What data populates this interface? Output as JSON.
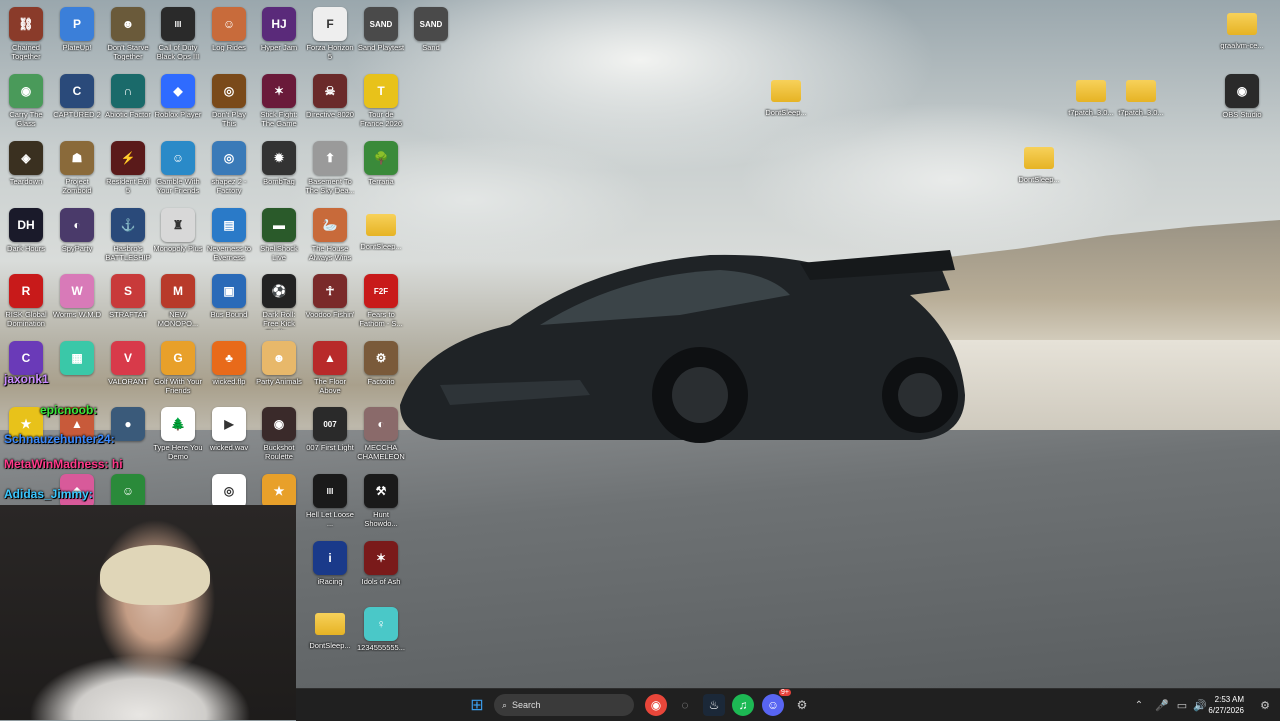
{
  "desktop": {
    "icons": [
      {
        "label": "Chained Together",
        "color": "#8a3b2a",
        "glyph": "⛓"
      },
      {
        "label": "PlateUp!",
        "color": "#3b7fd9",
        "glyph": "P"
      },
      {
        "label": "Don't Starve Together",
        "color": "#6a5a3a",
        "glyph": "☻"
      },
      {
        "label": "Call of Duty Black Ops III",
        "color": "#2a2a2a",
        "glyph": "III"
      },
      {
        "label": "Log Rides",
        "color": "#c86b3b",
        "glyph": "☺"
      },
      {
        "label": "Hyper Jam",
        "color": "#5a2a7a",
        "glyph": "HJ"
      },
      {
        "label": "Forza Horizon 5",
        "color": "#eeeeee",
        "glyph": "F"
      },
      {
        "label": "Sand Playtest",
        "color": "#4a4a4a",
        "glyph": "SAND"
      },
      {
        "label": "Sand",
        "color": "#4a4a4a",
        "glyph": "SAND"
      },
      {
        "label": "Carry The Glass",
        "color": "#4a9a5a",
        "glyph": "◉"
      },
      {
        "label": "CAPTURED 2",
        "color": "#2a4a7a",
        "glyph": "C"
      },
      {
        "label": "Abiotic Factor",
        "color": "#1a6a6a",
        "glyph": "∩"
      },
      {
        "label": "Roblox Player",
        "color": "#2f6bff",
        "glyph": "◆"
      },
      {
        "label": "Don't Play This",
        "color": "#7a4a1a",
        "glyph": "◎"
      },
      {
        "label": "Stick Fight: The Game",
        "color": "#6a1a3a",
        "glyph": "✶"
      },
      {
        "label": "Directive 8020",
        "color": "#6a2a2a",
        "glyph": "☠"
      },
      {
        "label": "Tour de France 2026",
        "color": "#e8c21a",
        "glyph": "T"
      },
      {
        "label": "Teardown",
        "color": "#3a3020",
        "glyph": "◈"
      },
      {
        "label": "Project Zomboid",
        "color": "#8a6a3a",
        "glyph": "☗"
      },
      {
        "label": "Resident Evil 5",
        "color": "#5a1a1a",
        "glyph": "⚡"
      },
      {
        "label": "Gamble With Your Friends",
        "color": "#2a8ac8",
        "glyph": "☺"
      },
      {
        "label": "shapez 2 - Factory",
        "color": "#3a7ab8",
        "glyph": "◎"
      },
      {
        "label": "BombTag",
        "color": "#333333",
        "glyph": "✹"
      },
      {
        "label": "Basement To The Sky Dea...",
        "color": "#9a9a9a",
        "glyph": "⬆"
      },
      {
        "label": "Terraria",
        "color": "#3a8a3a",
        "glyph": "🌳"
      },
      {
        "label": "Dark Hours",
        "color": "#1a1a2a",
        "glyph": "DH"
      },
      {
        "label": "SpyParty",
        "color": "#4a3a6a",
        "glyph": "◐"
      },
      {
        "label": "Hasbro's BATTLESHIP",
        "color": "#2a4a7a",
        "glyph": "⚓"
      },
      {
        "label": "Monopoly Plus",
        "color": "#d8d8d8",
        "glyph": "♜"
      },
      {
        "label": "Neverness to Everness",
        "color": "#2a7ac8",
        "glyph": "▤"
      },
      {
        "label": "ShellShock Live",
        "color": "#2a5a2a",
        "glyph": "▬"
      },
      {
        "label": "The House Always Wins",
        "color": "#c86a3a",
        "glyph": "🦢"
      },
      {
        "label": "DontSleep...",
        "color": "#f0c030",
        "glyph": "",
        "folder": true
      },
      {
        "label": "RISK Global Domination",
        "color": "#c81a1a",
        "glyph": "R"
      },
      {
        "label": "Worms W.M.D",
        "color": "#d87ab8",
        "glyph": "W"
      },
      {
        "label": "STRAFTAT",
        "color": "#c83a3a",
        "glyph": "S"
      },
      {
        "label": "NEW MONOPO...",
        "color": "#b83a2a",
        "glyph": "M"
      },
      {
        "label": "Bus Bound",
        "color": "#2a6ab8",
        "glyph": "▣"
      },
      {
        "label": "Dark Roll: Free Kick Challe...",
        "color": "#222222",
        "glyph": "⚽"
      },
      {
        "label": "Voodoo Fishin'",
        "color": "#7a2a2a",
        "glyph": "☥"
      },
      {
        "label": "Fears to Fathom - S...",
        "color": "#c81a1a",
        "glyph": "F2F"
      },
      {
        "label": "",
        "color": "#6a3ab8",
        "glyph": "C"
      },
      {
        "label": "",
        "color": "#3ac8a8",
        "glyph": "▦"
      },
      {
        "label": "VALORANT",
        "color": "#d83a4a",
        "glyph": "V"
      },
      {
        "label": "Golf With Your Friends",
        "color": "#e8a02a",
        "glyph": "G"
      },
      {
        "label": "wicked.flp",
        "color": "#e86a1a",
        "glyph": "♣"
      },
      {
        "label": "Party Animals",
        "color": "#e8b86a",
        "glyph": "☻"
      },
      {
        "label": "The Floor Above",
        "color": "#b82a2a",
        "glyph": "▲"
      },
      {
        "label": "Factorio",
        "color": "#7a5a3a",
        "glyph": "⚙"
      },
      {
        "label": "",
        "color": "#e8c21a",
        "glyph": "★"
      },
      {
        "label": "",
        "color": "#c85a3a",
        "glyph": "▲"
      },
      {
        "label": "",
        "color": "#3a5a7a",
        "glyph": "●"
      },
      {
        "label": "Type Here You Demo",
        "color": "#ffffff",
        "glyph": "🌲"
      },
      {
        "label": "wicked.wav",
        "color": "#ffffff",
        "glyph": "▶"
      },
      {
        "label": "Buckshot Roulette",
        "color": "#3a2a2a",
        "glyph": "◉"
      },
      {
        "label": "007 First Light",
        "color": "#2a2a2a",
        "glyph": "007"
      },
      {
        "label": "MECCHA CHAMELEON",
        "color": "#8a6a6a",
        "glyph": "◐"
      },
      {
        "label": "",
        "color": "#d85a9a",
        "glyph": "◆"
      },
      {
        "label": "",
        "color": "#2a8a3a",
        "glyph": "☺"
      },
      {
        "label": "",
        "color": "#ffffff",
        "glyph": "◎"
      },
      {
        "label": "",
        "color": "#e8a02a",
        "glyph": "★"
      },
      {
        "label": "Hell Let Loose ...",
        "color": "#1a1a1a",
        "glyph": "III"
      },
      {
        "label": "Hunt Showdo...",
        "color": "#1a1a1a",
        "glyph": "⚒"
      },
      {
        "label": "iRacing",
        "color": "#1a3a8a",
        "glyph": "i"
      },
      {
        "label": "Idols of Ash",
        "color": "#7a1a1a",
        "glyph": "✶"
      },
      {
        "label": "DontSleep...",
        "color": "#f0c030",
        "glyph": "",
        "folder": true
      },
      {
        "label": "1234555555...",
        "color": "#4ac8c8",
        "glyph": "♀"
      },
      {
        "label": "DontSleep...",
        "color": "#f0c030",
        "glyph": "",
        "folder": true
      },
      {
        "label": "t7patch_3.0...",
        "color": "#f0c030",
        "glyph": "",
        "folder": true
      },
      {
        "label": "t7patch_3.0...",
        "color": "#f0c030",
        "glyph": "",
        "folder": true
      },
      {
        "label": "graalvm-ce...",
        "color": "#f0c030",
        "glyph": "",
        "folder": true
      },
      {
        "label": "OBS Studio",
        "color": "#2a2a2a",
        "glyph": "◉"
      },
      {
        "label": "DontSleep...",
        "color": "#f0c030",
        "glyph": "",
        "folder": true
      }
    ]
  },
  "stream_overlay": {
    "chat": [
      {
        "text": "jaxonk1",
        "color": "#c88aff"
      },
      {
        "text": "epicnoob:",
        "color": "#3ae83a"
      },
      {
        "text": "Schnauzehunter24:",
        "color": "#3a8aff"
      },
      {
        "text": "MetaWinMadness: hi",
        "color": "#ff3a8a"
      },
      {
        "text": "Adidas_Jimmy:",
        "color": "#3ac8ff"
      }
    ]
  },
  "taskbar": {
    "search_label": "Search",
    "apps": [
      {
        "name": "start",
        "glyph": "⊞",
        "color": "#3a9ae8"
      },
      {
        "name": "chrome",
        "glyph": "◉",
        "color": "#e8463a"
      },
      {
        "name": "clipchamp",
        "glyph": "◌",
        "color": "#8a8a8a"
      },
      {
        "name": "steam",
        "glyph": "♨",
        "color": "#1b2838"
      },
      {
        "name": "spotify",
        "glyph": "♫",
        "color": "#1db954"
      },
      {
        "name": "discord",
        "glyph": "☺",
        "color": "#5865f2"
      },
      {
        "name": "settings",
        "glyph": "⚙",
        "color": "#555555"
      }
    ],
    "discord_badge": "9+",
    "time": "2:53 AM",
    "date": "6/27/2026"
  }
}
